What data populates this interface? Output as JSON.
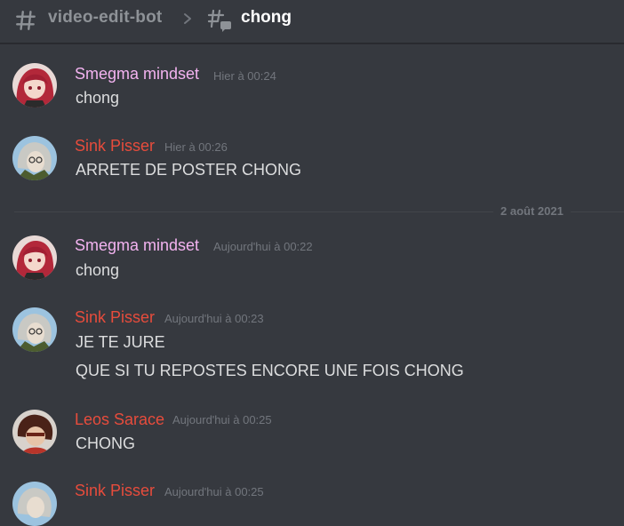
{
  "header": {
    "parent_channel": "video-edit-bot",
    "thread_name": "chong",
    "icons": {
      "channel": "hash-icon",
      "separator": "chevron-right-icon",
      "thread": "thread-icon"
    }
  },
  "colors": {
    "background": "#36393f",
    "text": "#dcddde",
    "timestamp": "#72767d",
    "pink_author": "#f3b3f0",
    "red_author": "#e74c3c"
  },
  "divider": {
    "label": "2 août 2021"
  },
  "messages": [
    {
      "author": "Smegma mindset",
      "author_color": "#f3b3f0",
      "timestamp": "Hier à 00:24",
      "lines": [
        "chong"
      ]
    },
    {
      "author": "Sink Pisser",
      "author_color": "#e74c3c",
      "timestamp": "Hier à 00:26",
      "lines": [
        "ARRETE DE POSTER CHONG"
      ]
    },
    {
      "author": "Smegma mindset",
      "author_color": "#f3b3f0",
      "timestamp": "Aujourd'hui à 00:22",
      "lines": [
        "chong"
      ]
    },
    {
      "author": "Sink Pisser",
      "author_color": "#e74c3c",
      "timestamp": "Aujourd'hui à 00:23",
      "lines": [
        "JE TE JURE",
        "QUE SI TU REPOSTES ENCORE UNE FOIS CHONG"
      ]
    },
    {
      "author": "Leos Sarace",
      "author_color": "#e74c3c",
      "timestamp": "Aujourd'hui à 00:25",
      "lines": [
        "CHONG"
      ]
    },
    {
      "author": "Sink Pisser",
      "author_color": "#e74c3c",
      "timestamp": "Aujourd'hui à 00:25",
      "lines": []
    }
  ]
}
